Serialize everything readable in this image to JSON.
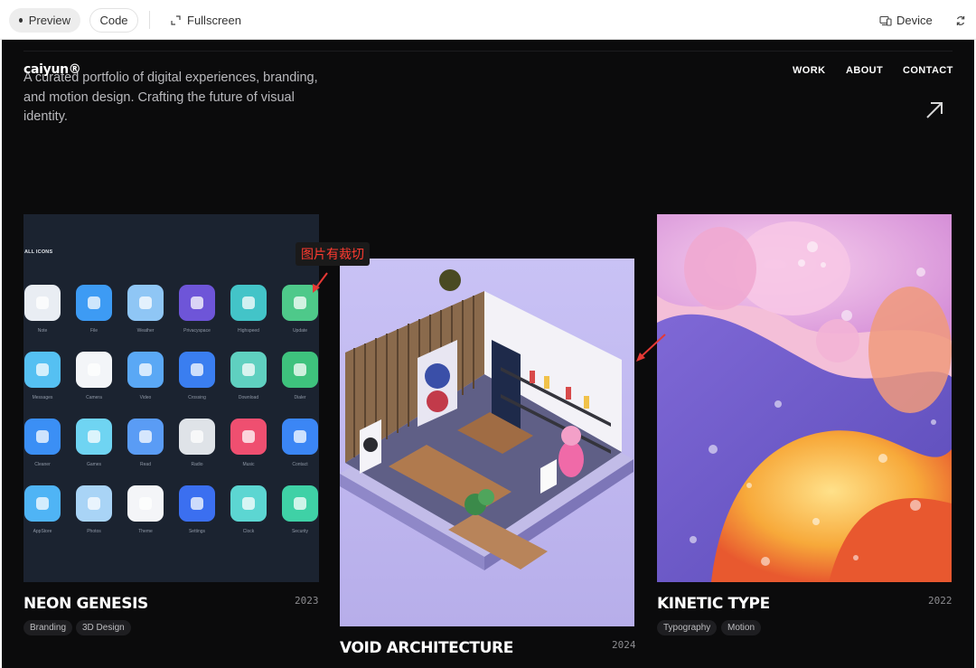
{
  "toolbar": {
    "preview_label": "Preview",
    "code_label": "Code",
    "fullscreen_label": "Fullscreen",
    "device_label": "Device"
  },
  "site": {
    "logo": "caiyun®",
    "nav": [
      "WORK",
      "ABOUT",
      "CONTACT"
    ],
    "tagline": "A curated portfolio of digital experiences, branding, and motion design. Crafting the future of visual identity."
  },
  "projects": [
    {
      "title": "NEON GENESIS",
      "year": "2023",
      "tags": [
        "Branding",
        "3D Design"
      ],
      "grid_label": "ALL ICONS",
      "apps": [
        {
          "name": "Note",
          "color": "#e9edf3"
        },
        {
          "name": "File",
          "color": "#3d9bf4"
        },
        {
          "name": "Weather",
          "color": "#8fc6f5"
        },
        {
          "name": "Privacyspace",
          "color": "#6e55d8"
        },
        {
          "name": "Highspeed",
          "color": "#43c4c8"
        },
        {
          "name": "Update",
          "color": "#4ec98a"
        },
        {
          "name": "Messages",
          "color": "#55c0f2"
        },
        {
          "name": "Camera",
          "color": "#f3f5f8"
        },
        {
          "name": "Video",
          "color": "#5aa8f5"
        },
        {
          "name": "Crossing",
          "color": "#3a7ef0"
        },
        {
          "name": "Download",
          "color": "#5fd0c0"
        },
        {
          "name": "Dialer",
          "color": "#3ec27d"
        },
        {
          "name": "Cleaner",
          "color": "#3b8ff5"
        },
        {
          "name": "Games",
          "color": "#6fd4f2"
        },
        {
          "name": "Read",
          "color": "#5a9cf5"
        },
        {
          "name": "Radio",
          "color": "#dfe3e8"
        },
        {
          "name": "Music",
          "color": "#ef4f70"
        },
        {
          "name": "Contact",
          "color": "#3b86f5"
        },
        {
          "name": "AppStore",
          "color": "#4fb4f5"
        },
        {
          "name": "Photos",
          "color": "#a9d4f6"
        },
        {
          "name": "Theme",
          "color": "#f4f5f8"
        },
        {
          "name": "Settings",
          "color": "#3b6ff0"
        },
        {
          "name": "Clock",
          "color": "#5cd6d2"
        },
        {
          "name": "Security",
          "color": "#3fd1a6"
        }
      ]
    },
    {
      "title": "VOID ARCHITECTURE",
      "year": "2024",
      "tags": []
    },
    {
      "title": "KINETIC TYPE",
      "year": "2022",
      "tags": [
        "Typography",
        "Motion"
      ]
    }
  ],
  "annotation": {
    "text": "图片有裁切",
    "color": "#e53935"
  }
}
